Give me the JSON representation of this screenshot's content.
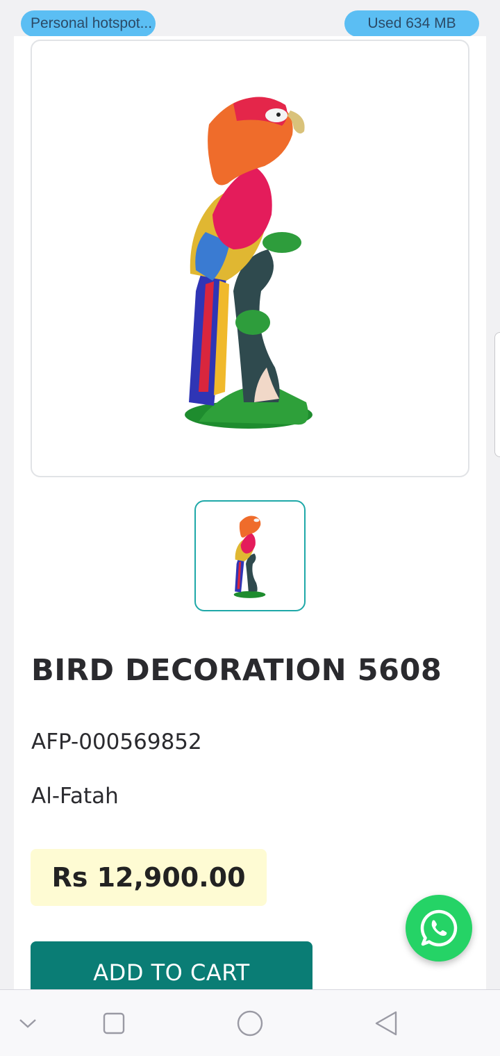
{
  "status_bar": {
    "hotspot_label": "Personal hotspot...",
    "data_used_label": "Used  634 MB"
  },
  "product": {
    "image_icon": "parrot-figurine-image",
    "thumbnail_icon": "parrot-figurine-thumbnail",
    "title": "BIRD DECORATION 5608",
    "sku": "AFP-000569852",
    "brand": "Al-Fatah",
    "price": "Rs 12,900.00",
    "add_to_cart_label": "ADD TO CART"
  },
  "floating": {
    "whatsapp_icon": "whatsapp-icon"
  },
  "nav_bar": {
    "items": [
      "collapse-chevron-icon",
      "recents-square-icon",
      "home-circle-icon",
      "back-triangle-icon"
    ]
  },
  "colors": {
    "accent_teal": "#0a7d75",
    "thumb_border": "#1ea8a8",
    "price_bg": "#fefbd3",
    "whatsapp_green": "#25d366",
    "status_pill": "#5bbef3"
  }
}
